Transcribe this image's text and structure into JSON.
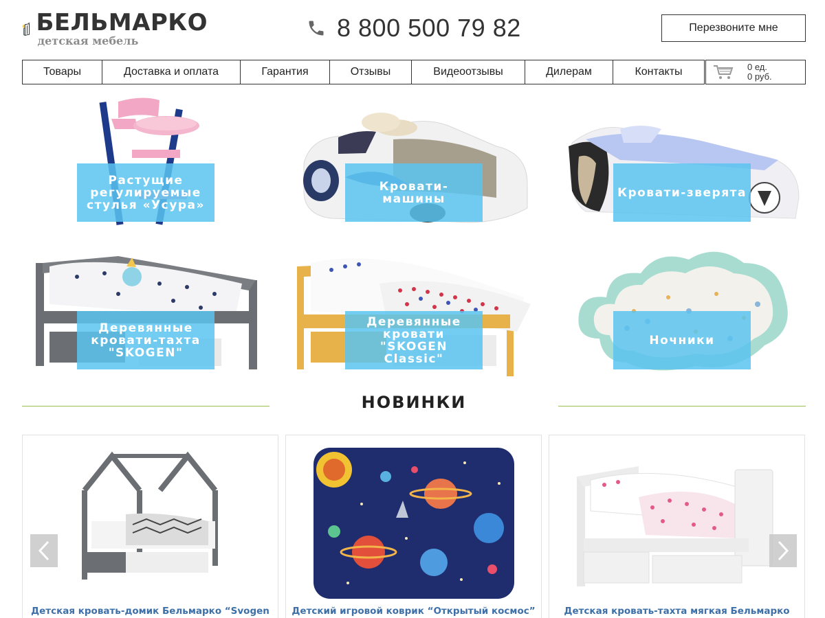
{
  "header": {
    "logo_title": "БЕЛЬМАРКО",
    "logo_subtitle": "детская мебель",
    "phone": "8 800 500 79 82",
    "callback_label": "Перезвоните мне"
  },
  "nav": {
    "items": [
      {
        "label": "Товары"
      },
      {
        "label": "Доставка и оплата"
      },
      {
        "label": "Гарантия"
      },
      {
        "label": "Отзывы"
      },
      {
        "label": "Видеоотзывы"
      },
      {
        "label": "Дилерам"
      },
      {
        "label": "Контакты"
      }
    ]
  },
  "cart": {
    "count": "0 ед.",
    "sum": "0 руб."
  },
  "categories": [
    {
      "label": "Растущие регулируемые стулья «Усура»"
    },
    {
      "label": "Кровати-машины"
    },
    {
      "label": "Кровати-зверята"
    },
    {
      "label": "Деревянные кровати-тахта \"SKOGEN\""
    },
    {
      "label": "Деревянные кровати \"SKOGEN Classic\""
    },
    {
      "label": "Ночники"
    }
  ],
  "section": {
    "title": "НОВИНКИ"
  },
  "products": [
    {
      "title": "Детская кровать-домик Бельмарко “Svogen"
    },
    {
      "title": "Детский игровой коврик “Открытый космос”"
    },
    {
      "title": "Детская кровать-тахта мягкая Бельмарко"
    }
  ],
  "colors": {
    "tile_overlay": "#5ac3ee",
    "section_line": "#9bbf4d",
    "product_title": "#3d6fa8"
  },
  "icons": {
    "phone": "phone-icon",
    "cart": "cart-icon",
    "prev": "chevron-left-icon",
    "next": "chevron-right-icon"
  }
}
